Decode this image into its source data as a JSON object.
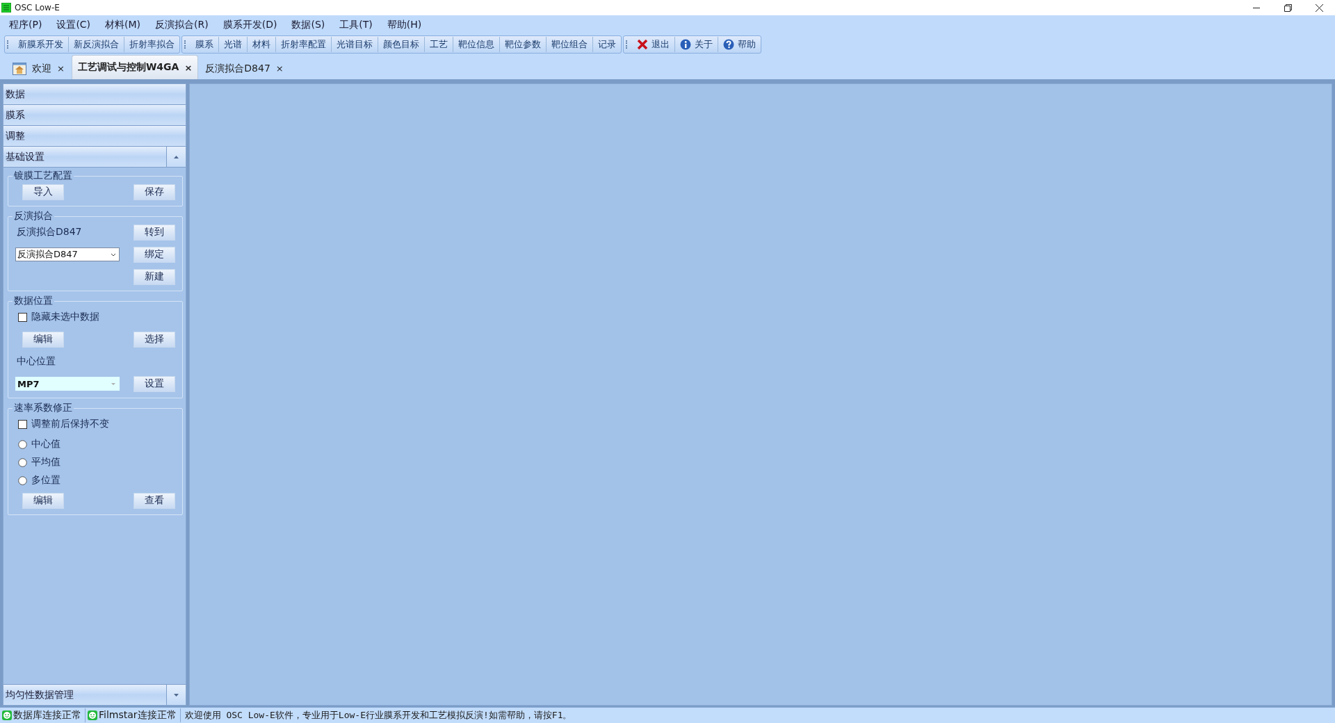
{
  "window": {
    "title": "OSC Low-E"
  },
  "menu": [
    "程序(P)",
    "设置(C)",
    "材料(M)",
    "反演拟合(R)",
    "膜系开发(D)",
    "数据(S)",
    "工具(T)",
    "帮助(H)"
  ],
  "toolbar": [
    {
      "items": [
        {
          "label": "新膜系开发"
        },
        {
          "label": "新反演拟合"
        },
        {
          "label": "折射率拟合"
        }
      ]
    },
    {
      "items": [
        {
          "label": "膜系"
        },
        {
          "label": "光谱"
        },
        {
          "label": "材料"
        },
        {
          "label": "折射率配置"
        },
        {
          "label": "光谱目标"
        },
        {
          "label": "颜色目标"
        },
        {
          "label": "工艺"
        },
        {
          "label": "靶位信息"
        },
        {
          "label": "靶位参数"
        },
        {
          "label": "靶位组合"
        },
        {
          "label": "记录"
        }
      ]
    },
    {
      "items": [
        {
          "label": "退出",
          "kind": "exit"
        },
        {
          "label": "关于",
          "kind": "info"
        },
        {
          "label": "帮助",
          "kind": "help"
        }
      ]
    }
  ],
  "tabs": [
    {
      "label": "欢迎",
      "selected": false,
      "kind": "home",
      "close": "×"
    },
    {
      "label": "工艺调试与控制W4GA",
      "selected": true,
      "kind": "plain",
      "close": "×"
    },
    {
      "label": "反演拟合D847",
      "selected": false,
      "kind": "plain",
      "close": "×"
    }
  ],
  "sidebar": {
    "headers": [
      {
        "label": "数据",
        "kind": "plain"
      },
      {
        "label": "膜系",
        "kind": "plain"
      },
      {
        "label": "调整",
        "kind": "plain"
      },
      {
        "label": "基础设置",
        "kind": "collapse"
      }
    ],
    "groups": [
      {
        "title": "镀膜工艺配置",
        "rows": [
          {
            "kind": "buttons",
            "buttons": [
              "导入",
              "保存"
            ]
          }
        ]
      },
      {
        "title": "反演拟合",
        "rows": [
          {
            "kind": "label_button",
            "label": "反演拟合D847",
            "button": "转到"
          },
          {
            "kind": "combo_list",
            "value": "反演拟合D847",
            "button": "绑定"
          },
          {
            "kind": "button_right",
            "button": "新建"
          }
        ]
      },
      {
        "title": "数据位置",
        "rows": [
          {
            "kind": "checkbox",
            "label": "隐藏未选中数据",
            "checked": false
          },
          {
            "kind": "buttons",
            "buttons": [
              "编辑",
              "选择"
            ]
          },
          {
            "kind": "label",
            "label": "中心位置"
          },
          {
            "kind": "combo_edit",
            "value": "MP7",
            "button": "设置"
          }
        ]
      },
      {
        "title": "速率系数修正",
        "rows": [
          {
            "kind": "checkbox",
            "label": "调整前后保持不变",
            "checked": false
          },
          {
            "kind": "radio",
            "label": "中心值",
            "selected": false
          },
          {
            "kind": "radio",
            "label": "平均值",
            "selected": false
          },
          {
            "kind": "radio",
            "label": "多位置",
            "selected": false
          },
          {
            "kind": "buttons",
            "buttons": [
              "编辑",
              "查看"
            ]
          }
        ]
      }
    ],
    "footer": {
      "label": "均匀性数据管理",
      "kind": "expand"
    }
  },
  "status_bar": {
    "items": [
      {
        "label": "数据库连接正常",
        "kind": "ok"
      },
      {
        "label": "Filmstar连接正常",
        "kind": "ok"
      }
    ],
    "message": "欢迎使用 OSC Low-E软件，专业用于Low-E行业膜系开发和工艺模拟反演!如需帮助，请按F1。"
  }
}
